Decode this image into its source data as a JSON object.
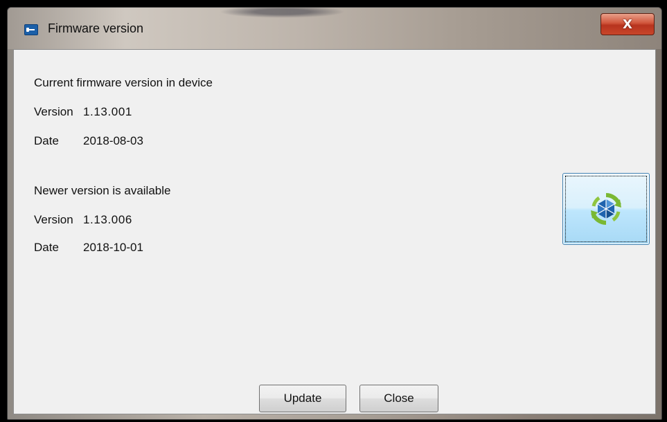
{
  "window": {
    "title": "Firmware version",
    "close_label": "X"
  },
  "current": {
    "heading": "Current firmware version in device",
    "version_label": "Version",
    "version_value": "1.13.001",
    "date_label": "Date",
    "date_value": "2018-08-03"
  },
  "newer": {
    "heading": "Newer version is available",
    "version_label": "Version",
    "version_value": "1.13.006",
    "date_label": "Date",
    "date_value": "2018-10-01"
  },
  "buttons": {
    "update_label": "Update",
    "close_label": "Close"
  },
  "icons": {
    "app": "app-icon",
    "update": "sync-update-icon"
  }
}
